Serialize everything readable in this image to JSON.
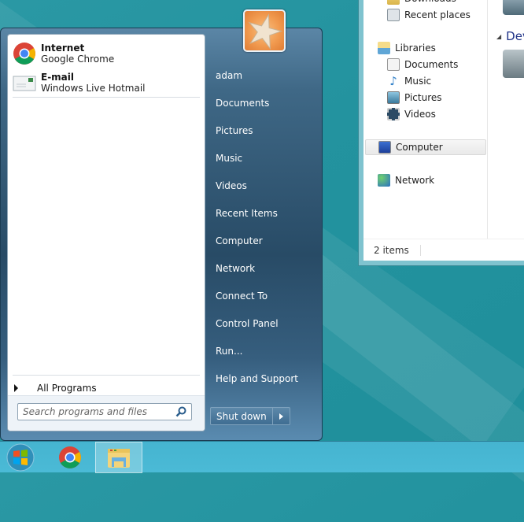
{
  "desktop": {
    "theme": "teal"
  },
  "explorer": {
    "nav_items": [
      {
        "label": "Downloads",
        "icon": "downloads-icon"
      },
      {
        "label": "Recent places",
        "icon": "recent-places-icon"
      },
      {
        "label": "Libraries",
        "icon": "libraries-icon"
      },
      {
        "label": "Documents",
        "icon": "documents-icon"
      },
      {
        "label": "Music",
        "icon": "music-icon"
      },
      {
        "label": "Pictures",
        "icon": "pictures-icon"
      },
      {
        "label": "Videos",
        "icon": "videos-icon"
      },
      {
        "label": "Computer",
        "icon": "computer-icon",
        "selected": true
      },
      {
        "label": "Network",
        "icon": "network-icon"
      }
    ],
    "content_group_label": "Dev",
    "status": "2 items"
  },
  "start_menu": {
    "pinned": [
      {
        "title": "Internet",
        "subtitle": "Google Chrome",
        "icon": "chrome-icon"
      },
      {
        "title": "E-mail",
        "subtitle": "Windows Live Hotmail",
        "icon": "email-icon"
      }
    ],
    "all_programs": "All Programs",
    "search_placeholder": "Search programs and files",
    "user": "adam",
    "right_items": [
      "Documents",
      "Pictures",
      "Music",
      "Videos",
      "Recent Items",
      "Computer",
      "Network",
      "Connect To",
      "Control Panel",
      "Run...",
      "Help and Support"
    ],
    "shutdown_label": "Shut down"
  },
  "taskbar": {
    "items": [
      {
        "name": "start-button",
        "icon": "windows-orb-icon"
      },
      {
        "name": "chrome-taskbar-button",
        "icon": "chrome-icon"
      },
      {
        "name": "explorer-taskbar-button",
        "icon": "folder-icon",
        "active": true
      }
    ]
  }
}
